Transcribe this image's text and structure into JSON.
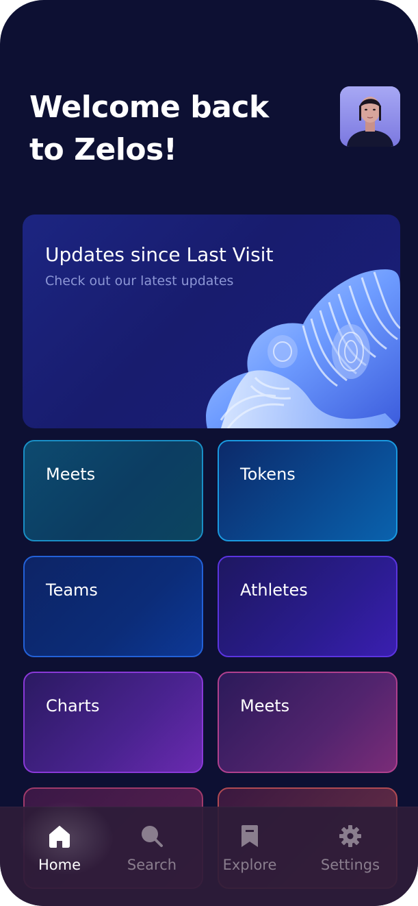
{
  "header": {
    "greeting_line1": "Welcome back",
    "greeting_line2": "to Zelos!"
  },
  "banner": {
    "title": "Updates since Last Visit",
    "subtitle": "Check out our latest updates"
  },
  "tiles": [
    {
      "label": "Meets"
    },
    {
      "label": "Tokens"
    },
    {
      "label": "Teams"
    },
    {
      "label": "Athletes"
    },
    {
      "label": "Charts"
    },
    {
      "label": "Meets"
    }
  ],
  "tabbar": {
    "items": [
      {
        "label": "Home",
        "icon": "home-icon",
        "active": true
      },
      {
        "label": "Search",
        "icon": "search-icon",
        "active": false
      },
      {
        "label": "Explore",
        "icon": "bookmark-icon",
        "active": false
      },
      {
        "label": "Settings",
        "icon": "gear-icon",
        "active": false
      }
    ]
  },
  "colors": {
    "background": "#0d1033",
    "active_tab": "#ffffff",
    "inactive_tab": "#8a7e8e"
  }
}
